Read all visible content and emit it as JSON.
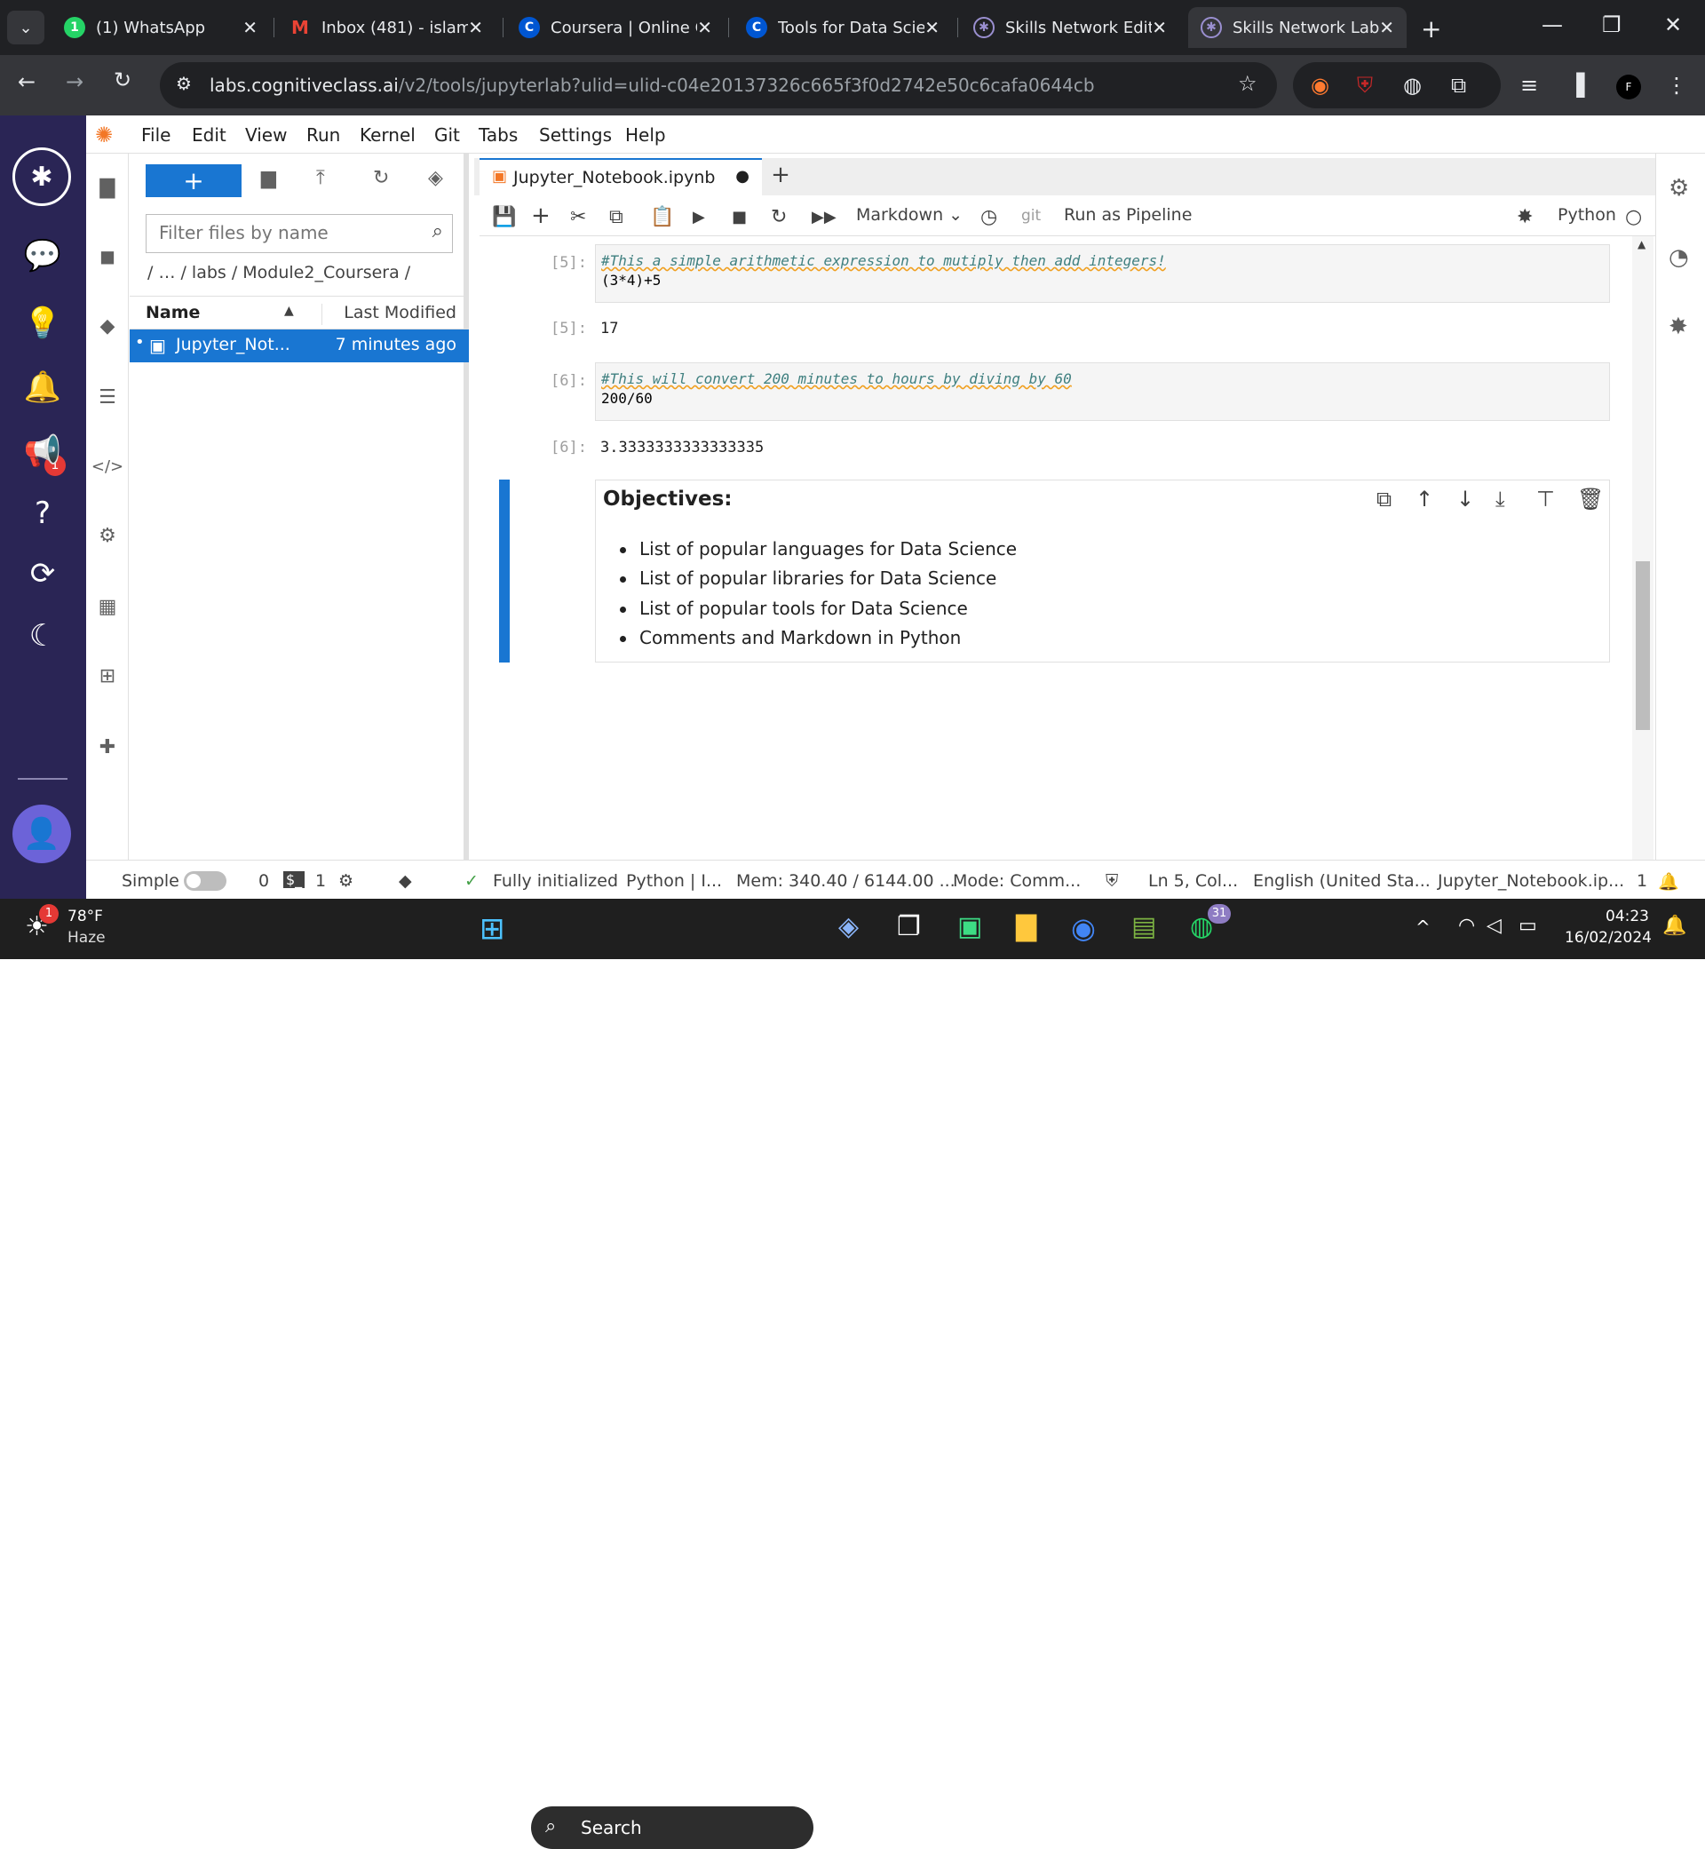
{
  "browser": {
    "tabs": [
      {
        "title": "(1) WhatsApp",
        "icon": "whatsapp-icon"
      },
      {
        "title": "Inbox (481) - islam",
        "icon": "gmail-icon"
      },
      {
        "title": "Coursera | Online C",
        "icon": "coursera-icon"
      },
      {
        "title": "Tools for Data Scie",
        "icon": "coursera-icon"
      },
      {
        "title": "Skills Network Edit",
        "icon": "skills-network-icon"
      },
      {
        "title": "Skills Network Labs",
        "icon": "skills-network-icon"
      }
    ],
    "url_host": "labs.cognitiveclass.ai",
    "url_rest": "/v2/tools/jupyterlab?ulid=ulid-c04e20137326c665f3f0d2742e50c6cafa0644cb",
    "profile_initial": "F"
  },
  "menu": [
    "File",
    "Edit",
    "View",
    "Run",
    "Kernel",
    "Git",
    "Tabs",
    "Settings",
    "Help"
  ],
  "filebrowser": {
    "filter_placeholder": "Filter files by name",
    "breadcrumbs": "/   …   / labs / Module2_Coursera /",
    "col_name": "Name",
    "col_modified": "Last Modified",
    "files": [
      {
        "name": "Jupyter_Not...",
        "modified": "7 minutes ago"
      }
    ]
  },
  "notebook": {
    "tab_title": "Jupyter_Notebook.ipynb",
    "cell_type": "Markdown",
    "git": "git",
    "run_pipeline": "Run as Pipeline",
    "kernel": "Python",
    "cells": [
      {
        "prompt": "[5]:",
        "comment": "#This a simple arithmetic expression to mutiply then add integers!",
        "code": "(3*4)+5",
        "out_prompt": "[5]:",
        "output": "17"
      },
      {
        "prompt": "[6]:",
        "comment": "#This will convert 200 minutes to hours by diving by 60",
        "code": "200/60",
        "out_prompt": "[6]:",
        "output": "3.3333333333333335"
      }
    ],
    "markdown": {
      "heading": "Objectives:",
      "items": [
        "List of popular languages for Data Science",
        "List of popular libraries for Data Science",
        "List of popular tools for Data Science",
        "Comments and Markdown in Python"
      ]
    }
  },
  "leftbar": {
    "notification_count": "1"
  },
  "status": {
    "mode_label": "Simple",
    "count0": "0",
    "count1": "1",
    "initialized": "Fully initialized",
    "kernel": "Python | I...",
    "mem": "Mem: 340.40 / 6144.00 ...",
    "mode": "Mode: Comm...",
    "ln": "Ln 5, Col...",
    "lang": "English (United Sta...",
    "file": "Jupyter_Notebook.ip...",
    "notif": "1"
  },
  "taskbar": {
    "temp": "78°F",
    "weather": "Haze",
    "weather_badge": "1",
    "search": "Search",
    "whatsapp_badge": "31",
    "time": "04:23",
    "date": "16/02/2024"
  }
}
